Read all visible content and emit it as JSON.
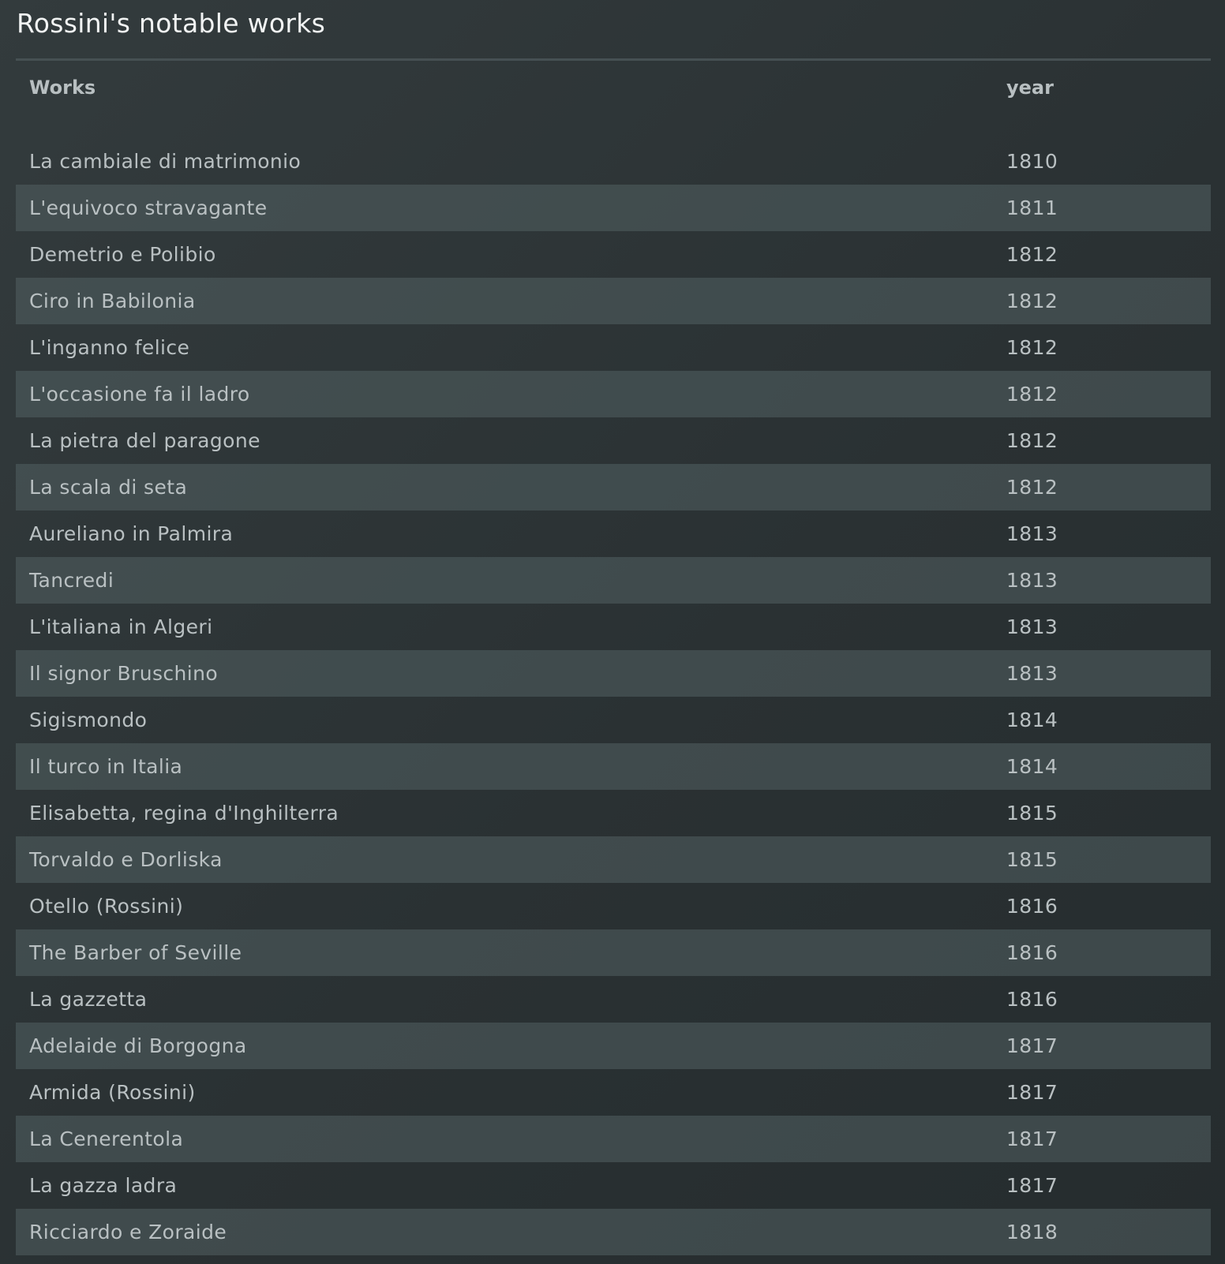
{
  "page": {
    "title": "Rossini's notable works"
  },
  "table": {
    "headers": {
      "work": "Works",
      "year": "year"
    },
    "rows": [
      {
        "work": "La cambiale di matrimonio",
        "year": "1810"
      },
      {
        "work": "L'equivoco stravagante",
        "year": "1811"
      },
      {
        "work": "Demetrio e Polibio",
        "year": "1812"
      },
      {
        "work": "Ciro in Babilonia",
        "year": "1812"
      },
      {
        "work": "L'inganno felice",
        "year": "1812"
      },
      {
        "work": "L'occasione fa il ladro",
        "year": "1812"
      },
      {
        "work": "La pietra del paragone",
        "year": "1812"
      },
      {
        "work": "La scala di seta",
        "year": "1812"
      },
      {
        "work": "Aureliano in Palmira",
        "year": "1813"
      },
      {
        "work": "Tancredi",
        "year": "1813"
      },
      {
        "work": "L'italiana in Algeri",
        "year": "1813"
      },
      {
        "work": "Il signor Bruschino",
        "year": "1813"
      },
      {
        "work": "Sigismondo",
        "year": "1814"
      },
      {
        "work": "Il turco in Italia",
        "year": "1814"
      },
      {
        "work": "Elisabetta, regina d'Inghilterra",
        "year": "1815"
      },
      {
        "work": "Torvaldo e Dorliska",
        "year": "1815"
      },
      {
        "work": "Otello (Rossini)",
        "year": "1816"
      },
      {
        "work": "The Barber of Seville",
        "year": "1816"
      },
      {
        "work": "La gazzetta",
        "year": "1816"
      },
      {
        "work": "Adelaide di Borgogna",
        "year": "1817"
      },
      {
        "work": "Armida (Rossini)",
        "year": "1817"
      },
      {
        "work": "La Cenerentola",
        "year": "1817"
      },
      {
        "work": "La gazza ladra",
        "year": "1817"
      },
      {
        "work": "Ricciardo e Zoraide",
        "year": "1818"
      }
    ]
  }
}
